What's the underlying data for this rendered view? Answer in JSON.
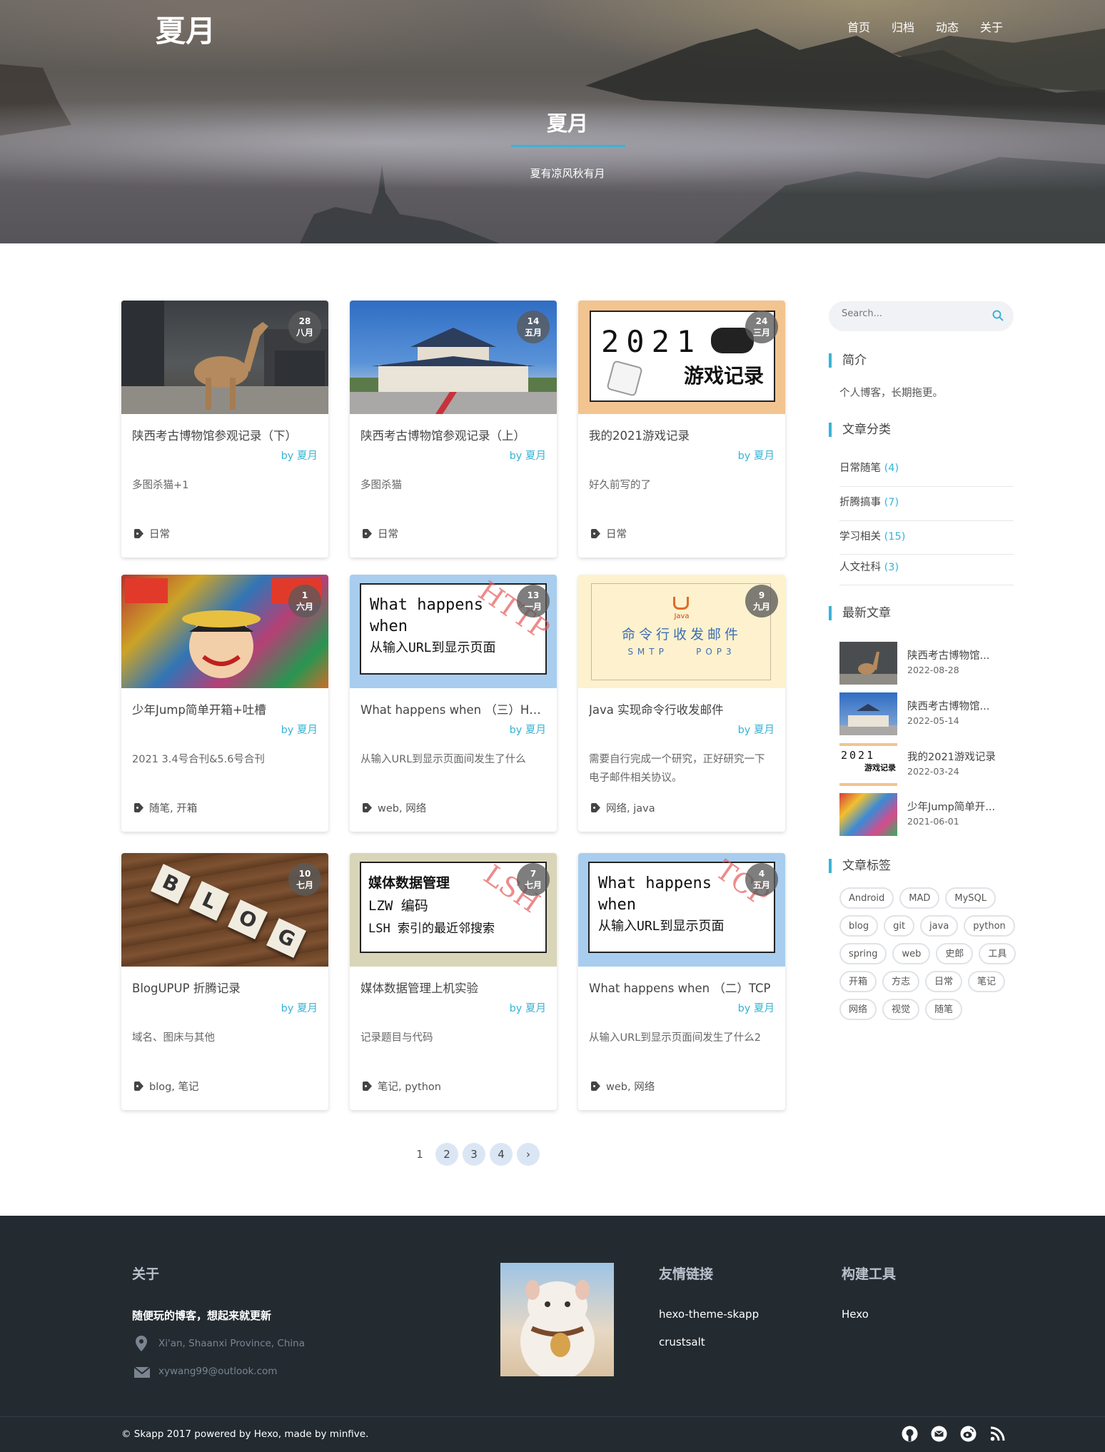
{
  "site": {
    "logo": "夏月",
    "nav": [
      "首页",
      "归档",
      "动态",
      "关于"
    ],
    "hero_title": "夏月",
    "hero_subtitle": "夏有凉风秋有月"
  },
  "posts": [
    {
      "day": "28",
      "month": "八月",
      "title": "陕西考古博物馆参观记录（下）",
      "by": "by",
      "author": "夏月",
      "excerpt": "多图杀猫+1",
      "tags": "日常",
      "image": "camel-statue"
    },
    {
      "day": "14",
      "month": "五月",
      "title": "陕西考古博物馆参观记录（上）",
      "by": "by",
      "author": "夏月",
      "excerpt": "多图杀猫",
      "tags": "日常",
      "image": "museum-building"
    },
    {
      "day": "24",
      "month": "三月",
      "title": "我的2021游戏记录",
      "by": "by",
      "author": "夏月",
      "excerpt": "好久前写的了",
      "tags": "日常",
      "image": "game-record",
      "img_lines": [
        "2021",
        "游戏记录"
      ]
    },
    {
      "day": "1",
      "month": "六月",
      "title": "少年Jump简单开箱+吐槽",
      "by": "by",
      "author": "夏月",
      "excerpt": "2021 3.4号合刊&5.6号合刊",
      "tags": "随笔, 开箱",
      "image": "jump-cover"
    },
    {
      "day": "13",
      "month": "一月",
      "title": "What happens when （三）HTTP",
      "by": "by",
      "author": "夏月",
      "excerpt": "从输入URL到显示页面间发生了什么",
      "tags": "web, 网络",
      "image": "http-sign",
      "img_lines": [
        "What happens",
        "when",
        "从输入URL到显示页面"
      ],
      "img_stamp": "HTTP"
    },
    {
      "day": "9",
      "month": "九月",
      "title": "Java 实现命令行收发邮件",
      "by": "by",
      "author": "夏月",
      "excerpt": "需要自行完成一个研究，正好研究一下电子邮件相关协议。",
      "tags": "网络, java",
      "image": "java-mail",
      "img_lines": [
        "Java",
        "命令行收发邮件",
        "SMTP    POP3"
      ]
    },
    {
      "day": "10",
      "month": "七月",
      "title": "BlogUPUP 折腾记录",
      "by": "by",
      "author": "夏月",
      "excerpt": "域名、图床与其他",
      "tags": "blog, 笔记",
      "image": "blog-tiles",
      "img_lines": [
        "B",
        "L",
        "O",
        "G"
      ]
    },
    {
      "day": "7",
      "month": "七月",
      "title": "媒体数据管理上机实验",
      "by": "by",
      "author": "夏月",
      "excerpt": "记录题目与代码",
      "tags": "笔记, python",
      "image": "media-sign",
      "img_lines": [
        "媒体数据管理",
        "LZW 编码",
        "LSH 索引的最近邻搜索"
      ],
      "img_stamp": "LSH"
    },
    {
      "day": "4",
      "month": "五月",
      "title": "What happens when （二）TCP",
      "by": "by",
      "author": "夏月",
      "excerpt": "从输入URL到显示页面间发生了什么2",
      "tags": "web, 网络",
      "image": "tcp-sign",
      "img_lines": [
        "What happens",
        "when",
        "从输入URL到显示页面"
      ],
      "img_stamp": "TCP"
    }
  ],
  "pager": [
    "1",
    "2",
    "3",
    "4",
    "›"
  ],
  "sidebar": {
    "search_placeholder": "Search...",
    "about_title": "简介",
    "about_text": "个人博客，长期拖更。",
    "categories_title": "文章分类",
    "categories": [
      {
        "name": "日常随笔",
        "count": "(4)"
      },
      {
        "name": "折腾搞事",
        "count": "(7)"
      },
      {
        "name": "学习相关",
        "count": "(15)"
      },
      {
        "name": "人文社科",
        "count": "(3)"
      }
    ],
    "recent_title": "最新文章",
    "recent": [
      {
        "title": "陕西考古博物馆...",
        "date": "2022-08-28"
      },
      {
        "title": "陕西考古博物馆...",
        "date": "2022-05-14"
      },
      {
        "title": "我的2021游戏记录",
        "date": "2022-03-24",
        "img_lines": [
          "2021",
          "游戏记录"
        ]
      },
      {
        "title": "少年Jump简单开...",
        "date": "2021-06-01"
      }
    ],
    "tags_title": "文章标签",
    "tags": [
      "Android",
      "MAD",
      "MySQL",
      "blog",
      "git",
      "java",
      "python",
      "spring",
      "web",
      "史郎",
      "工具",
      "开箱",
      "方志",
      "日常",
      "笔记",
      "网络",
      "视觉",
      "随笔"
    ]
  },
  "footer": {
    "about_title": "关于",
    "about_text": "随便玩的博客，想起来就更新",
    "location": "Xi'an, Shaanxi Province, China",
    "email": "xywang99@outlook.com",
    "links_title": "友情链接",
    "links": [
      "hexo-theme-skapp",
      "crustsalt"
    ],
    "tools_title": "构建工具",
    "tools": [
      "Hexo"
    ],
    "copyright": "© Skapp 2017 powered by Hexo, made by minfive."
  },
  "colors": {
    "accent": "#3ab3d6",
    "footer_bg": "#232b31"
  }
}
